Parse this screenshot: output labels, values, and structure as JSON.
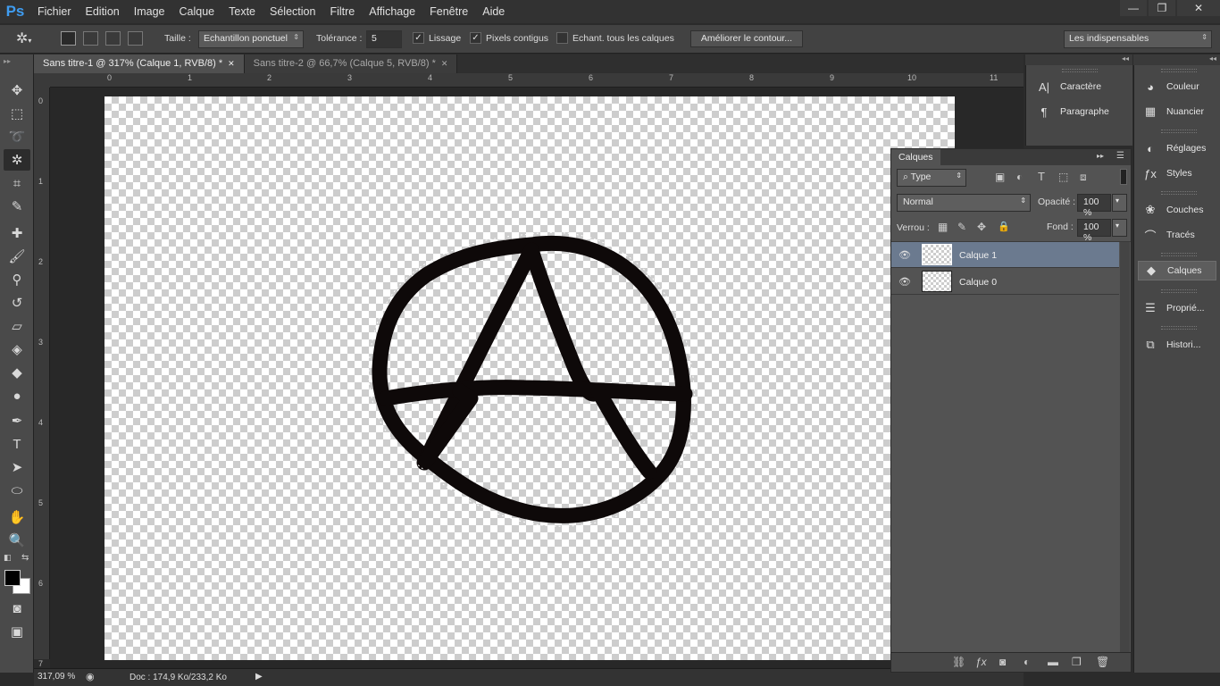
{
  "app": {
    "logo": "Ps"
  },
  "menu": [
    "Fichier",
    "Edition",
    "Image",
    "Calque",
    "Texte",
    "Sélection",
    "Filtre",
    "Affichage",
    "Fenêtre",
    "Aide"
  ],
  "window_controls": {
    "minimize": "—",
    "restore": "❐",
    "close": "✕"
  },
  "options": {
    "size_label": "Taille :",
    "size_value": "Echantillon ponctuel",
    "tolerance_label": "Tolérance :",
    "tolerance_value": "5",
    "antialias_label": "Lissage",
    "contiguous_label": "Pixels contigus",
    "sample_all_label": "Echant. tous les calques",
    "refine_button": "Améliorer le contour...",
    "workspace": "Les indispensables"
  },
  "tabs": [
    {
      "label": "Sans titre-1 @ 317% (Calque 1, RVB/8) *",
      "active": true
    },
    {
      "label": "Sans titre-2 @ 66,7% (Calque 5, RVB/8) *",
      "active": false
    }
  ],
  "rulers": {
    "h": [
      "0",
      "1",
      "2",
      "3",
      "4",
      "5",
      "6",
      "7",
      "8",
      "9",
      "10",
      "11"
    ],
    "v": [
      "0",
      "1",
      "2",
      "3",
      "4",
      "5",
      "6",
      "7"
    ]
  },
  "status": {
    "zoom": "317,09 %",
    "doc": "Doc : 174,9 Ko/233,2 Ko"
  },
  "layers_panel": {
    "title": "Calques",
    "filter": "Type",
    "blend_mode": "Normal",
    "opacity_label": "Opacité :",
    "opacity_value": "100 %",
    "lock_label": "Verrou :",
    "fill_label": "Fond :",
    "fill_value": "100 %",
    "layers": [
      {
        "name": "Calque 1",
        "selected": true
      },
      {
        "name": "Calque 0",
        "selected": false
      }
    ]
  },
  "dock1": [
    {
      "label": "Caractère",
      "icon": "character-icon"
    },
    {
      "label": "Paragraphe",
      "icon": "paragraph-icon"
    }
  ],
  "dock2": [
    {
      "label": "Couleur",
      "icon": "color-icon"
    },
    {
      "label": "Nuancier",
      "icon": "swatches-icon"
    },
    {
      "label": "Réglages",
      "icon": "adjustments-icon"
    },
    {
      "label": "Styles",
      "icon": "styles-icon"
    },
    {
      "label": "Couches",
      "icon": "channels-icon"
    },
    {
      "label": "Tracés",
      "icon": "paths-icon"
    },
    {
      "label": "Calques",
      "icon": "layers-icon"
    },
    {
      "label": "Proprié...",
      "icon": "properties-icon"
    },
    {
      "label": "Histori...",
      "icon": "history-icon"
    }
  ],
  "colors": {
    "selection": "#6b7a8f",
    "foreground": "#000000",
    "background": "#ffffff"
  }
}
